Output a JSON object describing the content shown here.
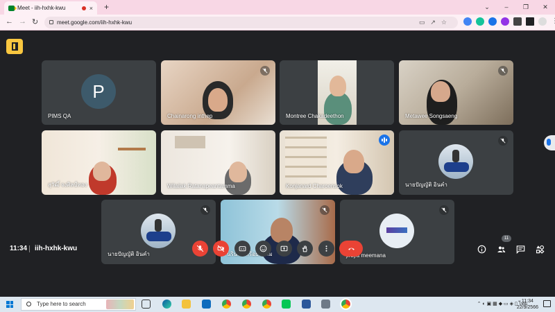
{
  "browser": {
    "tab_title": "Meet - iih-hxhk-kwu",
    "tab_close": "×",
    "new_tab": "+",
    "url": "meet.google.com/iih-hxhk-kwu",
    "window_minimize": "⌄",
    "window_min": "–",
    "window_max": "❐",
    "window_close": "✕"
  },
  "meet": {
    "participants": [
      {
        "name": "PIMS QA",
        "avatar_letter": "P",
        "muted": false
      },
      {
        "name": "Chainarong inthep",
        "muted": true
      },
      {
        "name": "Montree Chakadeethon",
        "muted": false
      },
      {
        "name": "Metawee Songsaeng",
        "muted": true
      },
      {
        "name": "สุวัฒิ์ จงศิลป์ทอง",
        "muted": false
      },
      {
        "name": "Wilailak Ratanapeantamma",
        "muted": false
      },
      {
        "name": "Konjanard Charoensok",
        "muted": false,
        "speaking": true
      },
      {
        "name": "นายปัญญัติ อินคำ",
        "muted": true
      },
      {
        "name": "นายปัญญัติ อินคำ",
        "muted": true
      },
      {
        "name": "นรินทร์ สร้อยพรหม",
        "muted": true
      },
      {
        "name": "jiraya meemana",
        "muted": true
      }
    ],
    "time": "11:34",
    "meeting_code": "iih-hxhk-kwu",
    "people_count": "11",
    "accent_red": "#ea4335",
    "accent_blue": "#1a73e8"
  },
  "taskbar": {
    "search_placeholder": "Type here to search",
    "language": "ไทย",
    "time": "11:34",
    "date": "22/9/2566"
  }
}
